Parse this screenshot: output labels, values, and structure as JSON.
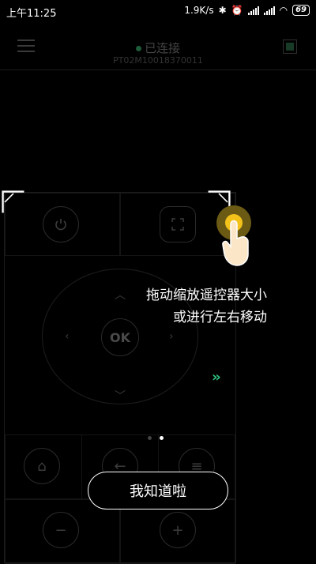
{
  "status_bar": {
    "time": "上午11:25",
    "net_speed": "1.9K/s",
    "battery": "69"
  },
  "header": {
    "status": "已连接",
    "device_id": "PT02M10018370011"
  },
  "remote": {
    "ok_label": "OK"
  },
  "overlay": {
    "hint_line1": "拖动缩放遥控器大小",
    "hint_line2": "或进行左右移动",
    "confirm_label": "我知道啦"
  },
  "colors": {
    "accent_green": "#2fbf7e",
    "drag_handle": "#f2c21b"
  }
}
